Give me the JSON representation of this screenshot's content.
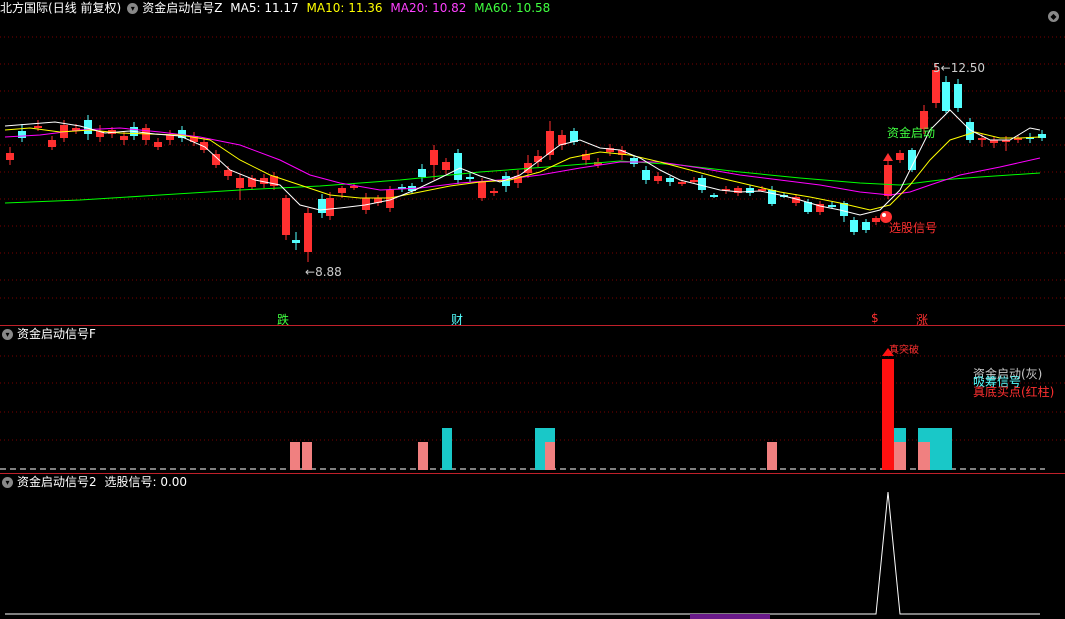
{
  "main": {
    "stock_name": "北方国际",
    "period_label": "(日线 前复权)",
    "indicator_name": "资金启动信号Z",
    "ma5": "MA5: 11.17",
    "ma10": "MA10: 11.36",
    "ma20": "MA20: 10.82",
    "ma60": "MA60: 10.58",
    "high_price": "12.50",
    "low_price": "8.88",
    "signal_start": "资金启动",
    "signal_pick": "选股信号",
    "markers": {
      "die": "跌",
      "cai": "财",
      "dollar": "$",
      "zhang": "涨"
    },
    "colors": {
      "ma5": "#ffffff",
      "ma10": "#ffff00",
      "ma20": "#ff00ff",
      "ma60": "#00ff00",
      "up": "#ff3030",
      "down": "#54ffff"
    }
  },
  "pane2": {
    "title": "资金启动信号F",
    "top_label": "真突破",
    "legend_1": "资金启动(灰)",
    "legend_2": "吸筹信号",
    "legend_3": "真底买点(红柱)"
  },
  "pane3": {
    "title": "资金启动信号2",
    "value": "选股信号: 0.00"
  }
}
